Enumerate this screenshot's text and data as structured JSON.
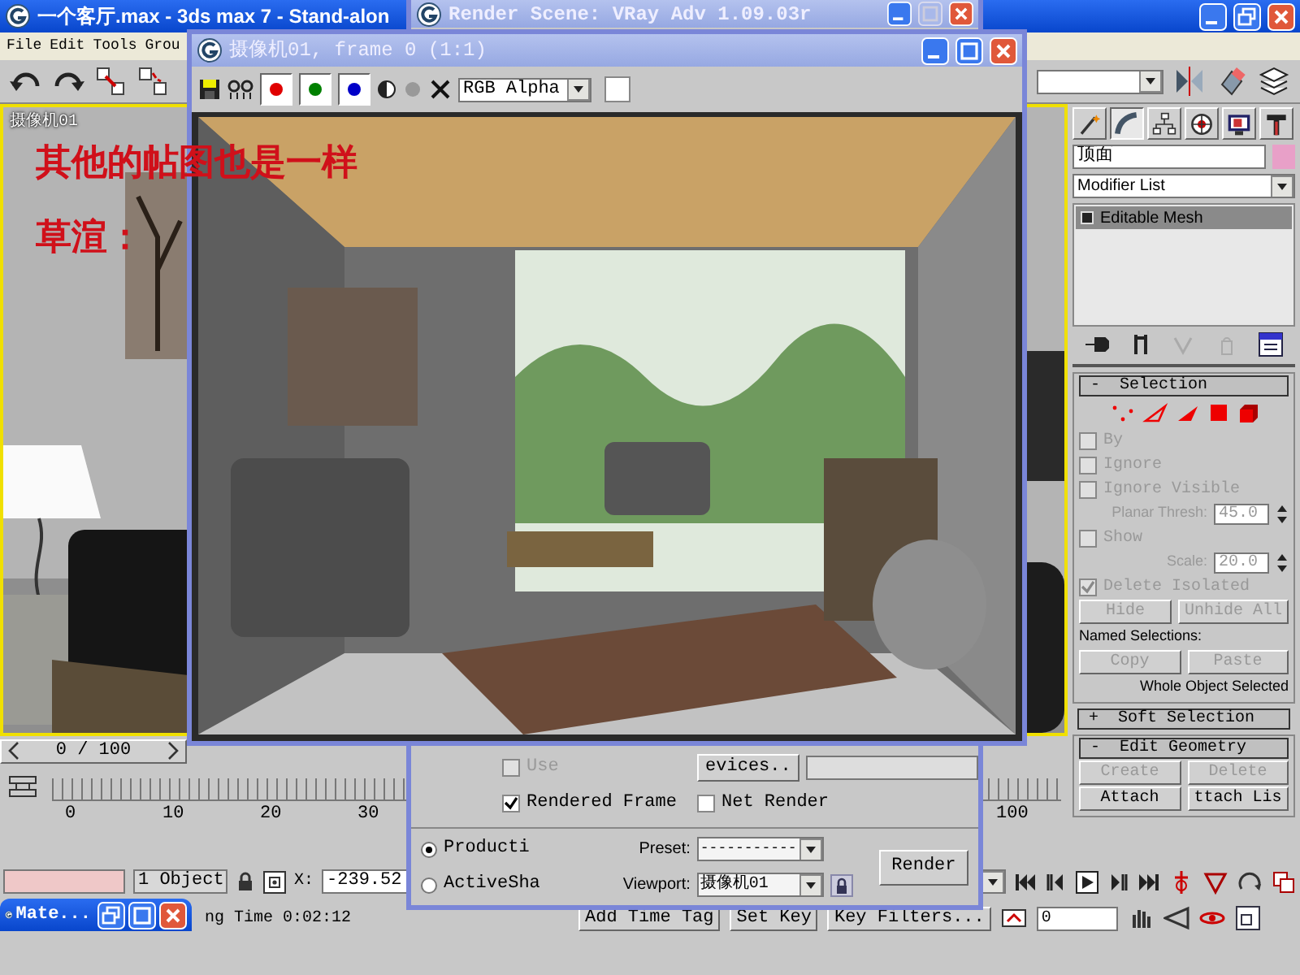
{
  "main_window": {
    "title": "一个客厅.max - 3ds max 7  - Stand-alon",
    "menu": [
      "File",
      "Edit",
      "Tools",
      "Grou"
    ]
  },
  "viewport": {
    "label": "摄像机01"
  },
  "annotation": [
    "其他的帖图也是一样",
    "草渲："
  ],
  "frame_buffer": {
    "title": "摄像机01, frame 0 (1:1)",
    "channels": [
      {
        "color": "#e00000",
        "on": true
      },
      {
        "color": "#008000",
        "on": true
      },
      {
        "color": "#0000c8",
        "on": true
      }
    ],
    "channel_select": "RGB Alpha"
  },
  "render_scene": {
    "title": "Render Scene: VRay Adv 1.09.03r",
    "option_rows": [
      [
        {
          "kind": "checkbox",
          "label": "Use",
          "checked": false,
          "disabled": true
        },
        {
          "kind": "button",
          "label": "evices.."
        },
        {
          "kind": "field"
        }
      ],
      [
        {
          "kind": "checkbox",
          "label": "Rendered Frame",
          "checked": true,
          "disabled": false
        },
        {
          "kind": "checkbox",
          "label": "Net Render",
          "checked": false,
          "disabled": false
        }
      ]
    ],
    "modes": [
      {
        "label": "Producti",
        "selected": true
      },
      {
        "label": "ActiveSha",
        "selected": false
      }
    ],
    "preset_label": "Preset:",
    "preset_value": "-----------",
    "viewport_label": "Viewport:",
    "viewport_value": "摄像机01",
    "render_button": "Render"
  },
  "command_panel": {
    "tabs": [
      {
        "kind": "create",
        "selected": false
      },
      {
        "kind": "modify",
        "selected": true
      },
      {
        "kind": "hierarchy",
        "selected": false
      },
      {
        "kind": "motion",
        "selected": false
      },
      {
        "kind": "display",
        "selected": false
      },
      {
        "kind": "utilities",
        "selected": false
      }
    ],
    "object_name": "顶面",
    "modifier_list": "Modifier List",
    "stack": [
      {
        "label": "Editable Mesh",
        "selected": true
      }
    ],
    "rollouts": [
      {
        "sign": "-",
        "title": "Selection",
        "items": [
          {
            "kind": "subobjects"
          },
          {
            "kind": "checkbox",
            "label": "By",
            "checked": false,
            "disabled": true
          },
          {
            "kind": "checkbox",
            "label": "Ignore",
            "checked": false,
            "disabled": true
          },
          {
            "kind": "checkbox",
            "label": "Ignore Visible",
            "checked": false,
            "disabled": true
          },
          {
            "kind": "spinner",
            "label": "Planar Thresh:",
            "value": "45.0"
          },
          {
            "kind": "checkbox",
            "label": "Show",
            "checked": false,
            "disabled": true
          },
          {
            "kind": "spinner",
            "label": "Scale:",
            "value": "20.0"
          },
          {
            "kind": "checkbox",
            "label": "Delete Isolated",
            "checked": true,
            "disabled": true
          },
          {
            "kind": "buttons",
            "buttons": [
              {
                "label": "Hide",
                "disabled": true
              },
              {
                "label": "Unhide All",
                "disabled": true
              }
            ]
          },
          {
            "kind": "text",
            "text": "Named Selections:"
          },
          {
            "kind": "buttons",
            "buttons": [
              {
                "label": "Copy",
                "disabled": true
              },
              {
                "label": "Paste",
                "disabled": true
              }
            ]
          },
          {
            "kind": "note",
            "text": "Whole Object Selected"
          }
        ]
      },
      {
        "sign": "+",
        "title": "Soft Selection"
      },
      {
        "sign": "-",
        "title": "Edit Geometry",
        "items": [
          {
            "kind": "buttons",
            "buttons": [
              {
                "label": "Create",
                "disabled": true
              },
              {
                "label": "Delete",
                "disabled": true
              }
            ]
          },
          {
            "kind": "buttons",
            "buttons": [
              {
                "label": "Attach",
                "disabled": false
              },
              {
                "label": "ttach Lis",
                "disabled": false
              }
            ]
          }
        ]
      }
    ]
  },
  "timeline": {
    "slider": "0 / 100",
    "ticks": [
      "0",
      "10",
      "20",
      "30",
      "100"
    ]
  },
  "status": {
    "selection": "1 Object",
    "x_label": "X:",
    "x_value": "-239.52",
    "time_label": "ng Time",
    "time_value": "0:02:12",
    "buttons": [
      "Add Time Tag",
      "Set Key",
      "Key Filters..."
    ],
    "frame_field": "0"
  },
  "minimized_window": {
    "title": "Mate..."
  }
}
